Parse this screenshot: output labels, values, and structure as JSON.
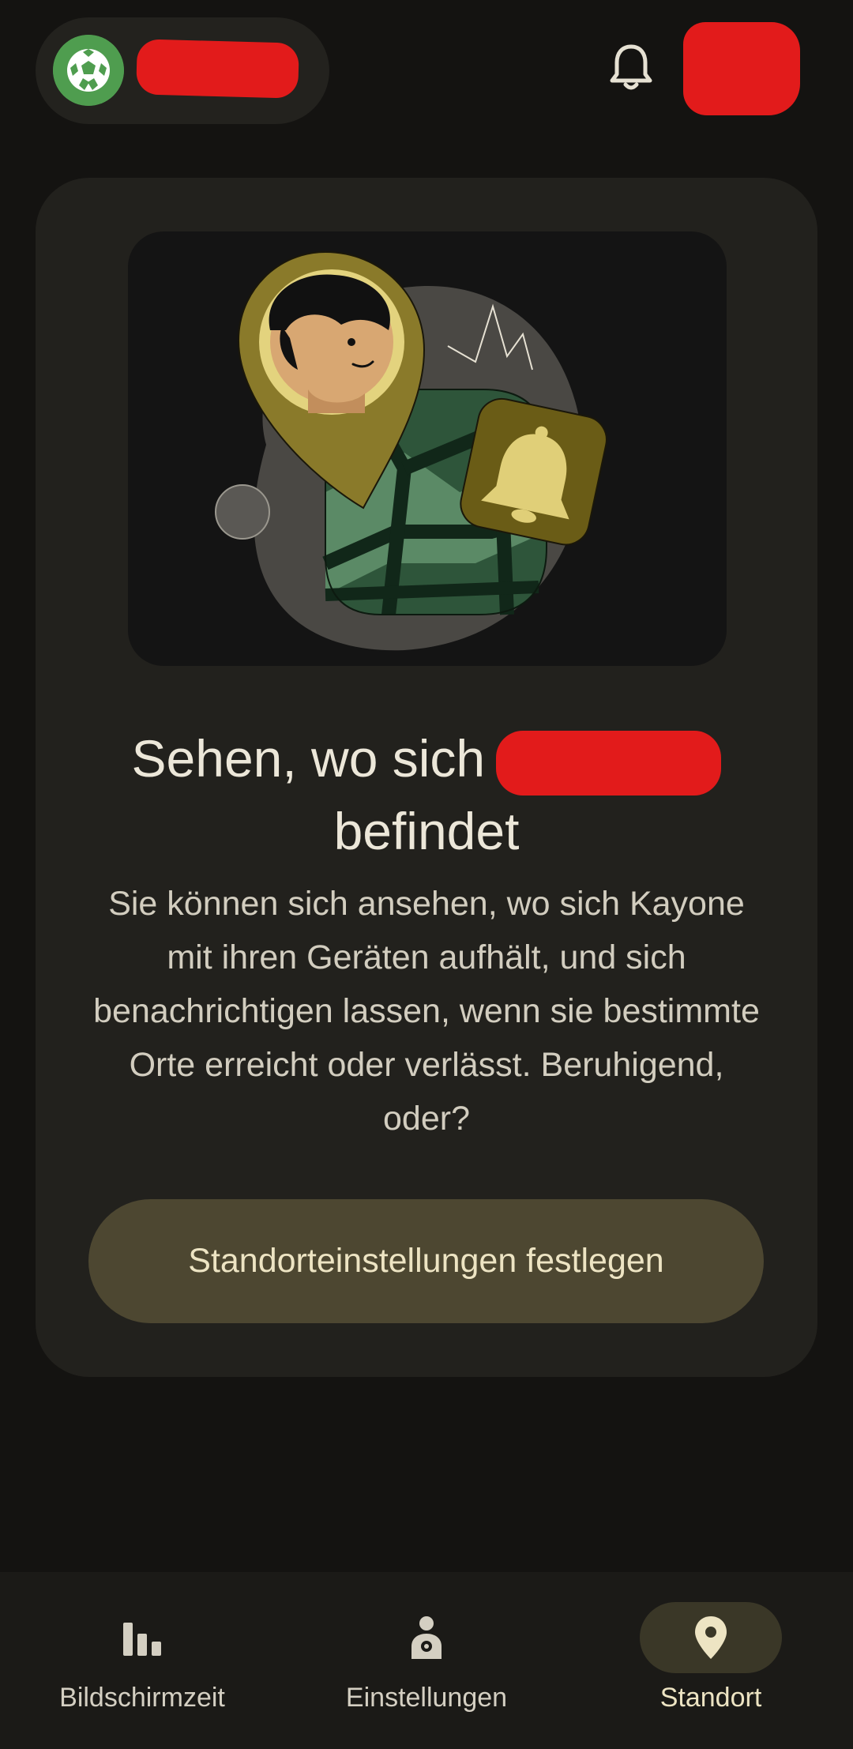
{
  "header": {
    "account_name_redacted": true,
    "notifications_icon": "bell-icon",
    "profile_redacted": true
  },
  "hero": {
    "headline_before": "Sehen, wo sich",
    "headline_after": "befindet",
    "body": "Sie können sich ansehen, wo sich Kayone mit ihren Geräten aufhält, und sich benachrichtigen lassen, wenn sie bestimmte Orte erreicht oder verlässt. Beruhigend, oder?",
    "cta_label": "Standorteinstellungen festlegen"
  },
  "bottom_nav": {
    "items": [
      {
        "label": "Bildschirmzeit",
        "icon": "bar-chart-icon",
        "active": false
      },
      {
        "label": "Einstellungen",
        "icon": "person-settings-icon",
        "active": false
      },
      {
        "label": "Standort",
        "icon": "location-pin-icon",
        "active": true
      }
    ]
  },
  "colors": {
    "background": "#141311",
    "card": "#22211d",
    "cta": "#4d4731",
    "redaction": "#e21b1b",
    "accent_green": "#4f9d4f"
  }
}
